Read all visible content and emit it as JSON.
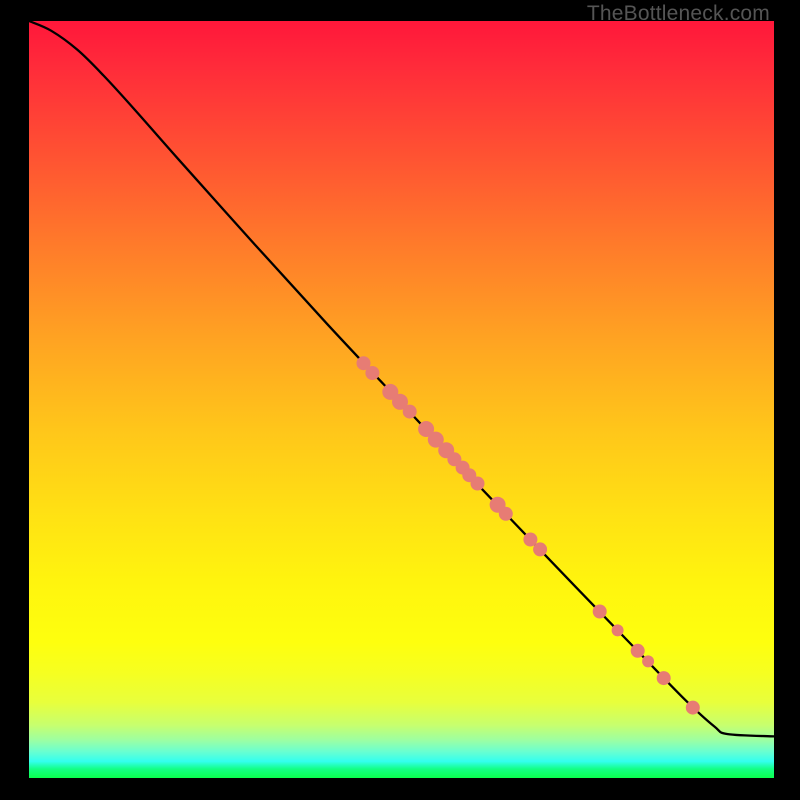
{
  "watermark": "TheBottleneck.com",
  "colors": {
    "dot": "#e77c74",
    "curve": "#000000",
    "frame": "#000000"
  },
  "chart_data": {
    "type": "line",
    "title": "",
    "xlabel": "",
    "ylabel": "",
    "xlim": [
      0,
      100
    ],
    "ylim": [
      0,
      100
    ],
    "note": "No axis ticks or numeric labels are rendered; values are positional estimates (0–100 internal plot coords, origin top-left of gradient area).",
    "curve": [
      {
        "x": 0.0,
        "y": 0.0
      },
      {
        "x": 3.0,
        "y": 1.3
      },
      {
        "x": 6.5,
        "y": 3.8
      },
      {
        "x": 10.0,
        "y": 7.2
      },
      {
        "x": 14.0,
        "y": 11.5
      },
      {
        "x": 20.0,
        "y": 18.2
      },
      {
        "x": 30.0,
        "y": 29.2
      },
      {
        "x": 40.0,
        "y": 40.0
      },
      {
        "x": 50.0,
        "y": 50.5
      },
      {
        "x": 60.0,
        "y": 61.0
      },
      {
        "x": 70.0,
        "y": 71.3
      },
      {
        "x": 80.0,
        "y": 81.5
      },
      {
        "x": 88.0,
        "y": 89.6
      },
      {
        "x": 92.0,
        "y": 93.2
      },
      {
        "x": 93.8,
        "y": 94.2
      },
      {
        "x": 100.0,
        "y": 94.5
      }
    ],
    "points": [
      {
        "x": 44.9,
        "y": 45.2,
        "r": 7
      },
      {
        "x": 46.1,
        "y": 46.5,
        "r": 7
      },
      {
        "x": 48.5,
        "y": 49.0,
        "r": 8
      },
      {
        "x": 49.8,
        "y": 50.3,
        "r": 8
      },
      {
        "x": 51.1,
        "y": 51.6,
        "r": 7
      },
      {
        "x": 53.3,
        "y": 53.9,
        "r": 8
      },
      {
        "x": 54.6,
        "y": 55.3,
        "r": 8
      },
      {
        "x": 56.0,
        "y": 56.7,
        "r": 8
      },
      {
        "x": 57.1,
        "y": 57.9,
        "r": 7
      },
      {
        "x": 58.2,
        "y": 59.0,
        "r": 7
      },
      {
        "x": 59.1,
        "y": 60.0,
        "r": 7
      },
      {
        "x": 60.2,
        "y": 61.1,
        "r": 7
      },
      {
        "x": 62.9,
        "y": 63.9,
        "r": 8
      },
      {
        "x": 64.0,
        "y": 65.1,
        "r": 7
      },
      {
        "x": 67.3,
        "y": 68.5,
        "r": 7
      },
      {
        "x": 68.6,
        "y": 69.8,
        "r": 7
      },
      {
        "x": 76.6,
        "y": 78.0,
        "r": 7
      },
      {
        "x": 79.0,
        "y": 80.5,
        "r": 6
      },
      {
        "x": 81.7,
        "y": 83.2,
        "r": 7
      },
      {
        "x": 83.1,
        "y": 84.6,
        "r": 6
      },
      {
        "x": 85.2,
        "y": 86.8,
        "r": 7
      },
      {
        "x": 89.1,
        "y": 90.7,
        "r": 7
      }
    ]
  }
}
